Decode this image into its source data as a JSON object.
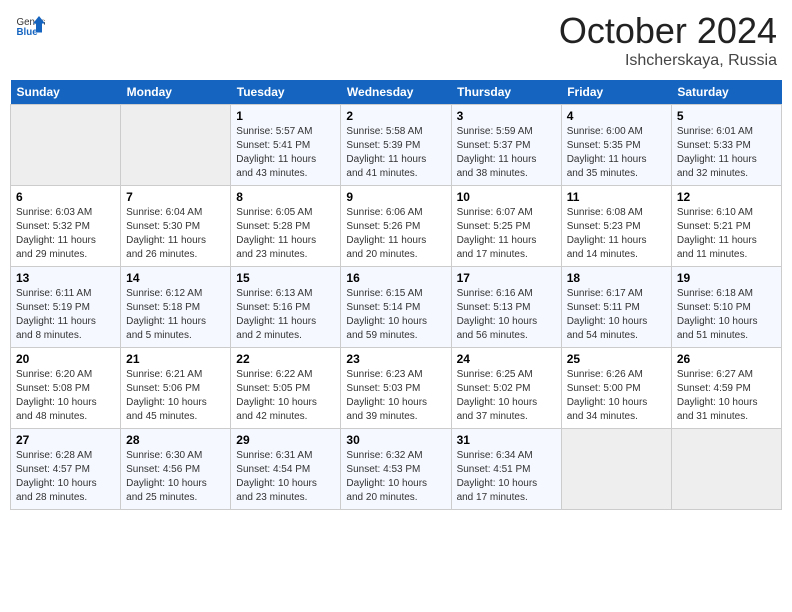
{
  "header": {
    "logo_general": "General",
    "logo_blue": "Blue",
    "month": "October 2024",
    "location": "Ishcherskaya, Russia"
  },
  "weekdays": [
    "Sunday",
    "Monday",
    "Tuesday",
    "Wednesday",
    "Thursday",
    "Friday",
    "Saturday"
  ],
  "weeks": [
    [
      {
        "day": "",
        "empty": true
      },
      {
        "day": "",
        "empty": true
      },
      {
        "day": "1",
        "sunrise": "5:57 AM",
        "sunset": "5:41 PM",
        "daylight": "11 hours and 43 minutes."
      },
      {
        "day": "2",
        "sunrise": "5:58 AM",
        "sunset": "5:39 PM",
        "daylight": "11 hours and 41 minutes."
      },
      {
        "day": "3",
        "sunrise": "5:59 AM",
        "sunset": "5:37 PM",
        "daylight": "11 hours and 38 minutes."
      },
      {
        "day": "4",
        "sunrise": "6:00 AM",
        "sunset": "5:35 PM",
        "daylight": "11 hours and 35 minutes."
      },
      {
        "day": "5",
        "sunrise": "6:01 AM",
        "sunset": "5:33 PM",
        "daylight": "11 hours and 32 minutes."
      }
    ],
    [
      {
        "day": "6",
        "sunrise": "6:03 AM",
        "sunset": "5:32 PM",
        "daylight": "11 hours and 29 minutes."
      },
      {
        "day": "7",
        "sunrise": "6:04 AM",
        "sunset": "5:30 PM",
        "daylight": "11 hours and 26 minutes."
      },
      {
        "day": "8",
        "sunrise": "6:05 AM",
        "sunset": "5:28 PM",
        "daylight": "11 hours and 23 minutes."
      },
      {
        "day": "9",
        "sunrise": "6:06 AM",
        "sunset": "5:26 PM",
        "daylight": "11 hours and 20 minutes."
      },
      {
        "day": "10",
        "sunrise": "6:07 AM",
        "sunset": "5:25 PM",
        "daylight": "11 hours and 17 minutes."
      },
      {
        "day": "11",
        "sunrise": "6:08 AM",
        "sunset": "5:23 PM",
        "daylight": "11 hours and 14 minutes."
      },
      {
        "day": "12",
        "sunrise": "6:10 AM",
        "sunset": "5:21 PM",
        "daylight": "11 hours and 11 minutes."
      }
    ],
    [
      {
        "day": "13",
        "sunrise": "6:11 AM",
        "sunset": "5:19 PM",
        "daylight": "11 hours and 8 minutes."
      },
      {
        "day": "14",
        "sunrise": "6:12 AM",
        "sunset": "5:18 PM",
        "daylight": "11 hours and 5 minutes."
      },
      {
        "day": "15",
        "sunrise": "6:13 AM",
        "sunset": "5:16 PM",
        "daylight": "11 hours and 2 minutes."
      },
      {
        "day": "16",
        "sunrise": "6:15 AM",
        "sunset": "5:14 PM",
        "daylight": "10 hours and 59 minutes."
      },
      {
        "day": "17",
        "sunrise": "6:16 AM",
        "sunset": "5:13 PM",
        "daylight": "10 hours and 56 minutes."
      },
      {
        "day": "18",
        "sunrise": "6:17 AM",
        "sunset": "5:11 PM",
        "daylight": "10 hours and 54 minutes."
      },
      {
        "day": "19",
        "sunrise": "6:18 AM",
        "sunset": "5:10 PM",
        "daylight": "10 hours and 51 minutes."
      }
    ],
    [
      {
        "day": "20",
        "sunrise": "6:20 AM",
        "sunset": "5:08 PM",
        "daylight": "10 hours and 48 minutes."
      },
      {
        "day": "21",
        "sunrise": "6:21 AM",
        "sunset": "5:06 PM",
        "daylight": "10 hours and 45 minutes."
      },
      {
        "day": "22",
        "sunrise": "6:22 AM",
        "sunset": "5:05 PM",
        "daylight": "10 hours and 42 minutes."
      },
      {
        "day": "23",
        "sunrise": "6:23 AM",
        "sunset": "5:03 PM",
        "daylight": "10 hours and 39 minutes."
      },
      {
        "day": "24",
        "sunrise": "6:25 AM",
        "sunset": "5:02 PM",
        "daylight": "10 hours and 37 minutes."
      },
      {
        "day": "25",
        "sunrise": "6:26 AM",
        "sunset": "5:00 PM",
        "daylight": "10 hours and 34 minutes."
      },
      {
        "day": "26",
        "sunrise": "6:27 AM",
        "sunset": "4:59 PM",
        "daylight": "10 hours and 31 minutes."
      }
    ],
    [
      {
        "day": "27",
        "sunrise": "6:28 AM",
        "sunset": "4:57 PM",
        "daylight": "10 hours and 28 minutes."
      },
      {
        "day": "28",
        "sunrise": "6:30 AM",
        "sunset": "4:56 PM",
        "daylight": "10 hours and 25 minutes."
      },
      {
        "day": "29",
        "sunrise": "6:31 AM",
        "sunset": "4:54 PM",
        "daylight": "10 hours and 23 minutes."
      },
      {
        "day": "30",
        "sunrise": "6:32 AM",
        "sunset": "4:53 PM",
        "daylight": "10 hours and 20 minutes."
      },
      {
        "day": "31",
        "sunrise": "6:34 AM",
        "sunset": "4:51 PM",
        "daylight": "10 hours and 17 minutes."
      },
      {
        "day": "",
        "empty": true
      },
      {
        "day": "",
        "empty": true
      }
    ]
  ]
}
